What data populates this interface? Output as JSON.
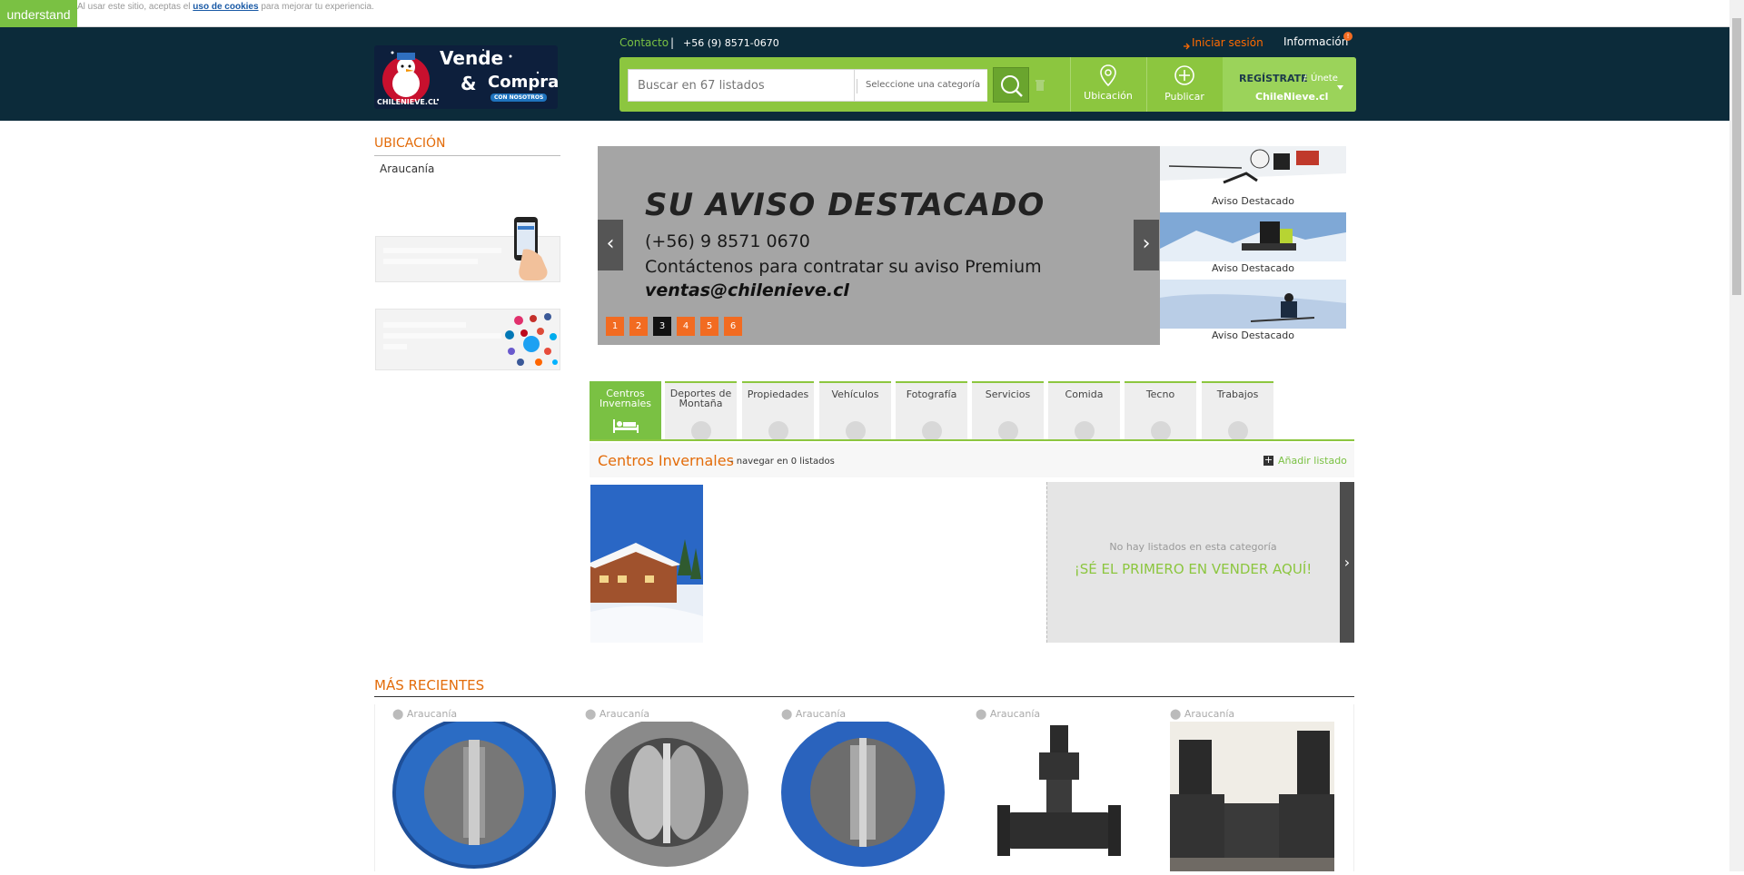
{
  "cookie": {
    "button": "understand",
    "text_before": "Al usar este sitio, aceptas el ",
    "link": "uso de cookies",
    "text_after": " para mejorar tu experiencia."
  },
  "header": {
    "logo": {
      "line1": "Vende",
      "amp": "&",
      "line2": "Compra",
      "badge": "CON NOSOTROS",
      "site": "CHILENIEVE.CL"
    },
    "contact_label": "Contacto",
    "separator": "|",
    "phone": "+56 (9) 8571-0670",
    "login": "Iniciar sesión",
    "info": "Información",
    "info_badge": "!",
    "search_placeholder": "Buscar en 67 listados",
    "category_placeholder": "Seleccione una categoría",
    "nav": {
      "location": "Ubicación",
      "publish": "Publicar"
    },
    "register": {
      "title": "REGÍSTRATE",
      "slash": "/",
      "join": "Únete",
      "site": "ChileNieve.cl"
    }
  },
  "sidebar": {
    "title": "UBICACIÓN",
    "location": "Araucanía"
  },
  "slider": {
    "title": "SU AVISO DESTACADO",
    "phone": "(+56) 9 8571 0670",
    "cta": "Contáctenos para contratar su aviso Premium",
    "email": "ventas@chilenieve.cl",
    "pages": [
      "1",
      "2",
      "3",
      "4",
      "5",
      "6"
    ],
    "active_page": "3",
    "prev": "‹",
    "next": "›",
    "thumb_label": "Aviso Destacado"
  },
  "tabs": [
    {
      "label": "Centros Invernales",
      "active": true
    },
    {
      "label": "Deportes de Montaña"
    },
    {
      "label": "Propiedades"
    },
    {
      "label": "Vehículos"
    },
    {
      "label": "Fotografía"
    },
    {
      "label": "Servicios"
    },
    {
      "label": "Comida"
    },
    {
      "label": "Tecno"
    },
    {
      "label": "Trabajos"
    }
  ],
  "section": {
    "title": "Centros Invernales",
    "subtitle": "- navegar en 0 listados",
    "add": "Añadir listado",
    "add_icon": "+",
    "empty_text": "No hay listados en esta categoría",
    "empty_cta": "¡SÉ EL PRIMERO EN VENDER AQUÍ!",
    "arrow": "›"
  },
  "recent": {
    "title": "MÁS RECIENTES",
    "items": [
      {
        "location": "Araucanía"
      },
      {
        "location": "Araucanía"
      },
      {
        "location": "Araucanía"
      },
      {
        "location": "Araucanía"
      },
      {
        "location": "Araucanía"
      }
    ]
  },
  "colors": {
    "header": "#0c2b3a",
    "green": "#8cc63f",
    "orange": "#e36c0a"
  }
}
